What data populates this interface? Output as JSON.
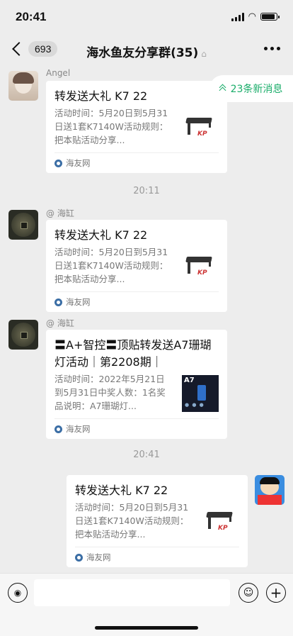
{
  "status": {
    "time": "20:41"
  },
  "nav": {
    "back_count": "693",
    "title": "海水鱼友分享群(35)"
  },
  "new_messages": {
    "label": "23条新消息"
  },
  "messages": [
    {
      "sender": "Angel",
      "title": "转发送大礼 K7 22",
      "desc": "活动时间：5月20日到5月31日送1套K7140W活动规则：把本贴活动分享...",
      "source": "海友网"
    },
    {
      "timestamp": "20:11"
    },
    {
      "sender": "@ 海缸",
      "title": "转发送大礼 K7 22",
      "desc": "活动时间：5月20日到5月31日送1套K7140W活动规则：把本贴活动分享...",
      "source": "海友网"
    },
    {
      "sender": "@ 海缸",
      "title": "〓A+智控〓顶贴转发送A7珊瑚灯活动｜第2208期｜",
      "desc": "活动时间：2022年5月21日到5月31日中奖人数：1名奖品说明：A7珊瑚灯...",
      "source": "海友网",
      "thumb_text": "A7"
    },
    {
      "timestamp": "20:41"
    },
    {
      "sender": "",
      "title": "转发送大礼 K7 22",
      "desc": "活动时间：5月20日到5月31日送1套K7140W活动规则：把本贴活动分享...",
      "source": "海友网"
    }
  ],
  "input": {
    "placeholder": ""
  },
  "thumb_logo": "KP"
}
